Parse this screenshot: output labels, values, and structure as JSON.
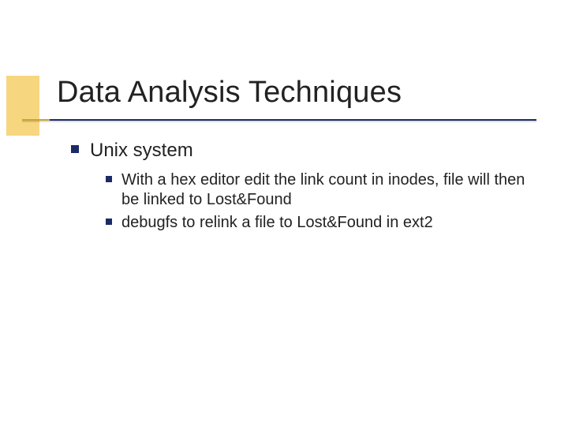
{
  "title": "Data Analysis Techniques",
  "body": {
    "item1": {
      "label": "Unix system",
      "sub1": "With a hex editor edit the link count in inodes, file will then be linked to Lost&Found",
      "sub2": "debugfs to relink a file to Lost&Found in ext2"
    }
  },
  "colors": {
    "accent_block": "#f0b418",
    "rule": "#1c2a66",
    "bullet": "#1c2a66"
  }
}
